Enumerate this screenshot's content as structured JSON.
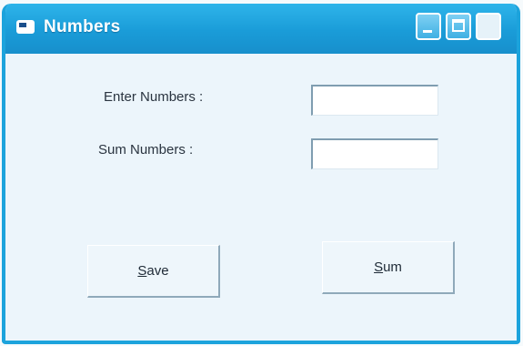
{
  "window": {
    "title": "Numbers"
  },
  "form": {
    "enter_label": "Enter Numbers :",
    "sum_label": "Sum Numbers :",
    "enter_value": "",
    "sum_value": ""
  },
  "buttons": {
    "save": {
      "accel": "S",
      "rest": "ave"
    },
    "sum": {
      "accel": "S",
      "rest": "um"
    }
  },
  "icons": {
    "app": "app-window-icon",
    "minimize": "minimize-icon",
    "maximize": "maximize-icon",
    "close": "close-icon"
  }
}
